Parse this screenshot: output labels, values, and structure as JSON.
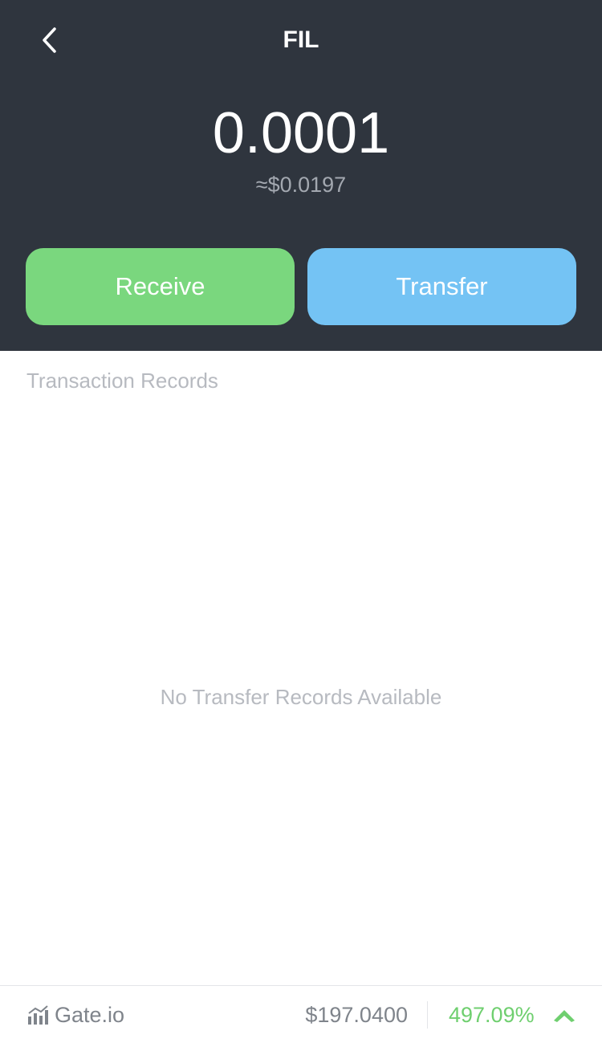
{
  "header": {
    "title": "FIL",
    "back_icon": "chevron-left-icon",
    "background": "#2f353e"
  },
  "balance": {
    "amount": "0.0001",
    "fiat": "≈$0.0197"
  },
  "actions": {
    "receive_label": "Receive",
    "transfer_label": "Transfer",
    "receive_color": "#7ad77e",
    "transfer_color": "#74c3f4"
  },
  "records": {
    "section_title": "Transaction Records",
    "empty_message": "No Transfer Records Available"
  },
  "ticker": {
    "exchange_icon": "bar-chart-icon",
    "exchange": "Gate.io",
    "price": "$197.0400",
    "change": "497.09%",
    "trend_icon": "chevron-up-icon",
    "change_color": "#6fcf6f"
  }
}
